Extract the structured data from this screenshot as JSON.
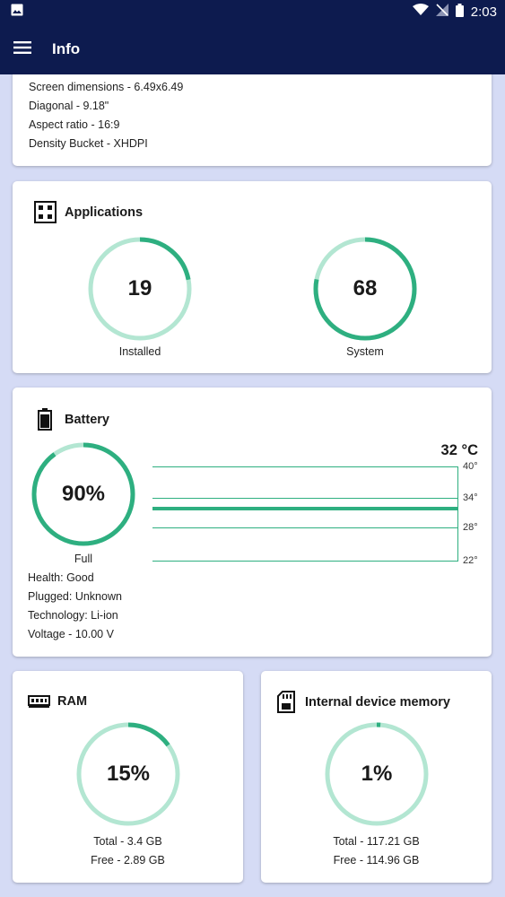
{
  "status": {
    "time": "2:03"
  },
  "appbar": {
    "title": "Info"
  },
  "display": {
    "lines": [
      "Screen dimensions - 6.49x6.49",
      "Diagonal - 9.18\"",
      "Aspect ratio - 16:9",
      "Density Bucket - XHDPI"
    ]
  },
  "applications": {
    "title": "Applications",
    "installed": {
      "value": "19",
      "label": "Installed",
      "fraction": 0.22
    },
    "system": {
      "value": "68",
      "label": "System",
      "fraction": 0.78
    }
  },
  "battery": {
    "title": "Battery",
    "level": "90%",
    "fraction": 0.9,
    "state": "Full",
    "temperature": "32 °C",
    "temperature_value": 32,
    "scale_ticks": [
      "40°",
      "34°",
      "28°",
      "22°"
    ],
    "details": [
      "Health: Good",
      "Plugged: Unknown",
      "Technology: Li-ion",
      "Voltage - 10.00 V"
    ]
  },
  "ram": {
    "title": "RAM",
    "percent": "15%",
    "fraction": 0.15,
    "total": "Total - 3.4 GB",
    "free": "Free - 2.89 GB"
  },
  "storage": {
    "title": "Internal device memory",
    "percent": "1%",
    "fraction": 0.01,
    "total": "Total - 117.21 GB",
    "free": "Free - 114.96 GB"
  },
  "colors": {
    "accent": "#2eaf80",
    "track": "#b3e6d2",
    "appbar": "#0d1b4f",
    "background": "#d5dbf5"
  }
}
